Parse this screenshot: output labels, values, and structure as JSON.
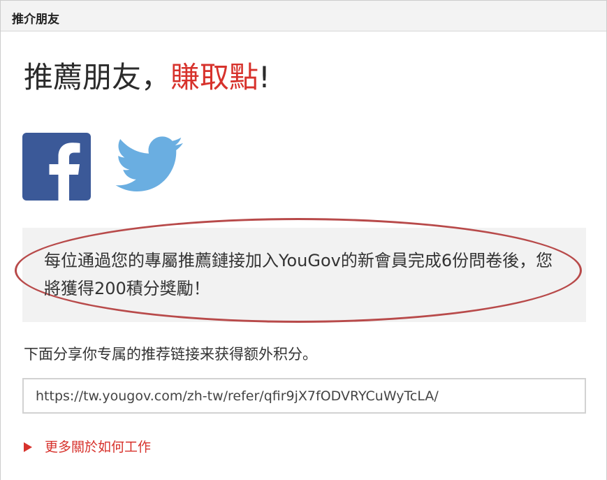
{
  "panel": {
    "title": "推介朋友"
  },
  "headline": {
    "prefix": "推薦朋友，",
    "accent": "賺取點",
    "suffix": "!"
  },
  "social": {
    "facebook_icon": "facebook-icon",
    "twitter_icon": "twitter-icon"
  },
  "reward": {
    "text": "每位通過您的專屬推薦鏈接加入YouGov的新會員完成6份問卷後，您將獲得200積分獎勵！"
  },
  "share": {
    "instruction": "下面分享你专属的推荐链接来获得额外积分。",
    "link_value": "https://tw.yougov.com/zh-tw/refer/qfir9jX7fODVRYCuWyTcLA/"
  },
  "more": {
    "label": "更多關於如何工作"
  },
  "colors": {
    "accent": "#d7322c",
    "facebook": "#3b5998",
    "twitter": "#6aaee1",
    "oval": "#b84a4a"
  }
}
